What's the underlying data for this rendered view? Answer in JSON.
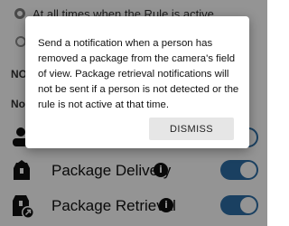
{
  "background": {
    "radio_options": [
      {
        "label": "At all times when the Rule is active",
        "selected": true
      },
      {
        "label": "",
        "selected": false
      }
    ],
    "section_labels": [
      "NOT",
      "Not"
    ]
  },
  "rules": [
    {
      "icon": "package-delivery-icon",
      "label": "Package Delivery",
      "enabled": true
    },
    {
      "icon": "package-retrieval-icon",
      "label": "Package Retrieval",
      "enabled": true
    }
  ],
  "dialog": {
    "message": "Send a notification when a person has removed a package from the camera's field of view. Package retrieval notifications will not be sent if a person is not detected or the rule is not active at that time.",
    "dismiss_label": "DISMISS"
  },
  "colors": {
    "toggle_on": "#2d6fa7",
    "scrim": "rgba(0,0,0,0.42)"
  }
}
